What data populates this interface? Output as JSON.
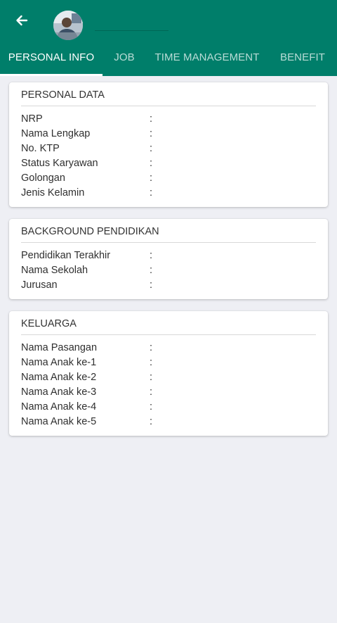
{
  "tabs": [
    {
      "label": "PERSONAL INFO"
    },
    {
      "label": "JOB"
    },
    {
      "label": "TIME MANAGEMENT"
    },
    {
      "label": "BENEFIT"
    }
  ],
  "colors": {
    "primary": "#007e6a",
    "background": "#eeeff4",
    "card": "#ffffff"
  },
  "sections": [
    {
      "title": "PERSONAL DATA",
      "rows": [
        {
          "label": "NRP",
          "sep": ":"
        },
        {
          "label": "Nama Lengkap",
          "sep": ":"
        },
        {
          "label": "No. KTP",
          "sep": ":"
        },
        {
          "label": "Status Karyawan",
          "sep": ":"
        },
        {
          "label": "Golongan",
          "sep": ":"
        },
        {
          "label": "Jenis Kelamin",
          "sep": ":"
        }
      ]
    },
    {
      "title": "BACKGROUND PENDIDIKAN",
      "rows": [
        {
          "label": "Pendidikan Terakhir",
          "sep": ":"
        },
        {
          "label": "Nama Sekolah",
          "sep": ":"
        },
        {
          "label": "Jurusan",
          "sep": ":"
        }
      ]
    },
    {
      "title": "KELUARGA",
      "rows": [
        {
          "label": "Nama Pasangan",
          "sep": ":"
        },
        {
          "label": "Nama Anak ke-1",
          "sep": ":"
        },
        {
          "label": "Nama Anak ke-2",
          "sep": ":"
        },
        {
          "label": "Nama Anak ke-3",
          "sep": ":"
        },
        {
          "label": "Nama Anak ke-4",
          "sep": ":"
        },
        {
          "label": "Nama Anak ke-5",
          "sep": ":"
        }
      ]
    }
  ]
}
